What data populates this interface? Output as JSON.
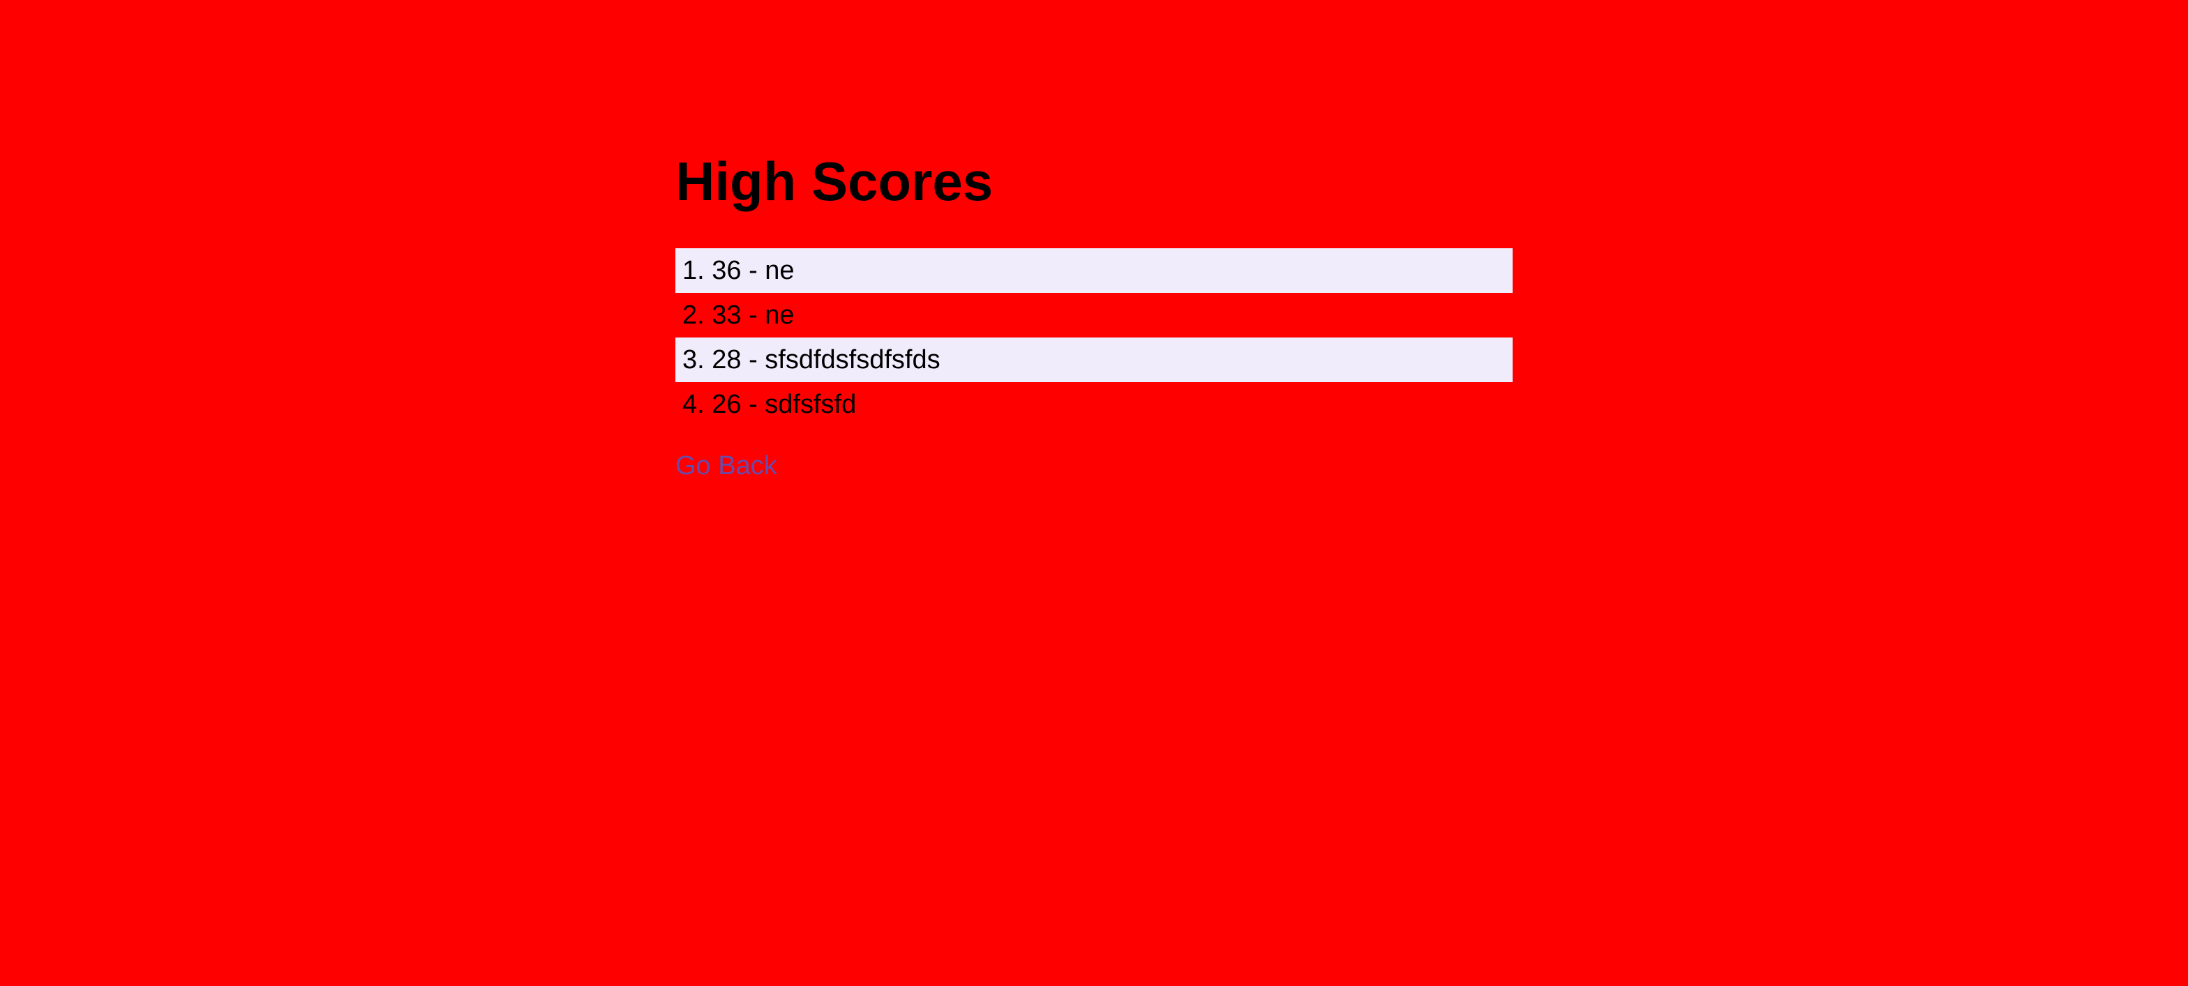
{
  "page": {
    "title": "High Scores",
    "background_color": "#ff0000"
  },
  "scores": [
    {
      "label": "1. 36 - ne"
    },
    {
      "label": "2. 33 - ne"
    },
    {
      "label": "3. 28 - sfsdfdsfsdfsfds"
    },
    {
      "label": "4. 26 - sdfsfsfd"
    }
  ],
  "navigation": {
    "go_back_label": "Go Back",
    "link_color": "#6a4aa8"
  },
  "row_highlight_color": "#f0ecfb"
}
